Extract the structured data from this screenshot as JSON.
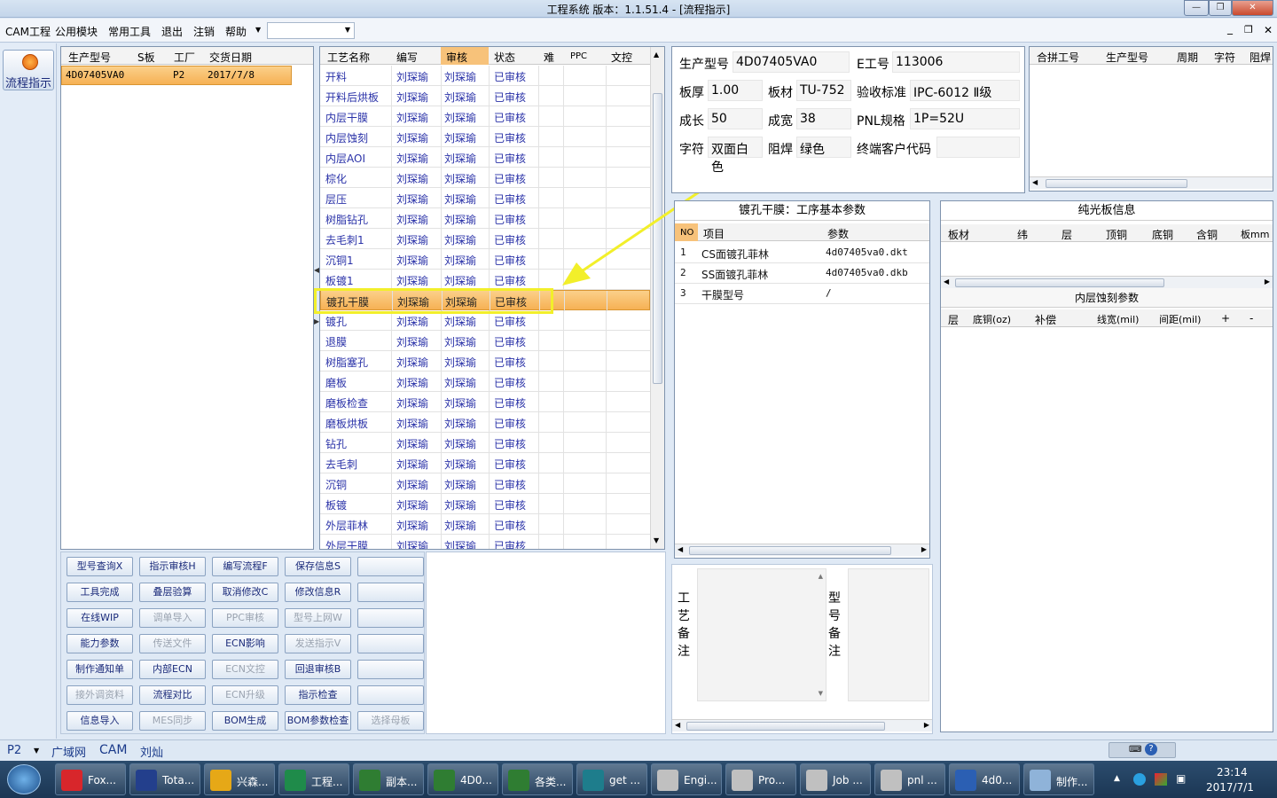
{
  "window": {
    "title": "工程系统  版本：1.1.51.4 - [流程指示]"
  },
  "menu": {
    "items": [
      "CAM工程",
      "公用模块",
      "常用工具",
      "退出",
      "注销",
      "帮助"
    ]
  },
  "side": {
    "flow_label": "流程指示"
  },
  "orders": {
    "headers": [
      "生产型号",
      "S板",
      "工厂",
      "交货日期"
    ],
    "rows": [
      {
        "model": "4D07405VA0",
        "s": "",
        "factory": "P2",
        "date": "2017/7/8"
      }
    ]
  },
  "process": {
    "headers": [
      "工艺名称",
      "编写",
      "审核",
      "状态",
      "难",
      "PPC",
      "文控"
    ],
    "rows": [
      {
        "name": "开料",
        "writer": "刘琛瑜",
        "checker": "刘琛瑜",
        "status": "已审核"
      },
      {
        "name": "开料后烘板",
        "writer": "刘琛瑜",
        "checker": "刘琛瑜",
        "status": "已审核"
      },
      {
        "name": "内层干膜",
        "writer": "刘琛瑜",
        "checker": "刘琛瑜",
        "status": "已审核"
      },
      {
        "name": "内层蚀刻",
        "writer": "刘琛瑜",
        "checker": "刘琛瑜",
        "status": "已审核"
      },
      {
        "name": "内层AOI",
        "writer": "刘琛瑜",
        "checker": "刘琛瑜",
        "status": "已审核"
      },
      {
        "name": "棕化",
        "writer": "刘琛瑜",
        "checker": "刘琛瑜",
        "status": "已审核"
      },
      {
        "name": "层压",
        "writer": "刘琛瑜",
        "checker": "刘琛瑜",
        "status": "已审核"
      },
      {
        "name": "树脂钻孔",
        "writer": "刘琛瑜",
        "checker": "刘琛瑜",
        "status": "已审核"
      },
      {
        "name": "去毛刺1",
        "writer": "刘琛瑜",
        "checker": "刘琛瑜",
        "status": "已审核"
      },
      {
        "name": "沉铜1",
        "writer": "刘琛瑜",
        "checker": "刘琛瑜",
        "status": "已审核"
      },
      {
        "name": "板镀1",
        "writer": "刘琛瑜",
        "checker": "刘琛瑜",
        "status": "已审核"
      },
      {
        "name": "镀孔干膜",
        "writer": "刘琛瑜",
        "checker": "刘琛瑜",
        "status": "已审核"
      },
      {
        "name": "镀孔",
        "writer": "刘琛瑜",
        "checker": "刘琛瑜",
        "status": "已审核"
      },
      {
        "name": "退膜",
        "writer": "刘琛瑜",
        "checker": "刘琛瑜",
        "status": "已审核"
      },
      {
        "name": "树脂塞孔",
        "writer": "刘琛瑜",
        "checker": "刘琛瑜",
        "status": "已审核"
      },
      {
        "name": "磨板",
        "writer": "刘琛瑜",
        "checker": "刘琛瑜",
        "status": "已审核"
      },
      {
        "name": "磨板检查",
        "writer": "刘琛瑜",
        "checker": "刘琛瑜",
        "status": "已审核"
      },
      {
        "name": "磨板烘板",
        "writer": "刘琛瑜",
        "checker": "刘琛瑜",
        "status": "已审核"
      },
      {
        "name": "钻孔",
        "writer": "刘琛瑜",
        "checker": "刘琛瑜",
        "status": "已审核"
      },
      {
        "name": "去毛刺",
        "writer": "刘琛瑜",
        "checker": "刘琛瑜",
        "status": "已审核"
      },
      {
        "name": "沉铜",
        "writer": "刘琛瑜",
        "checker": "刘琛瑜",
        "status": "已审核"
      },
      {
        "name": "板镀",
        "writer": "刘琛瑜",
        "checker": "刘琛瑜",
        "status": "已审核"
      },
      {
        "name": "外层菲林",
        "writer": "刘琛瑜",
        "checker": "刘琛瑜",
        "status": "已审核"
      },
      {
        "name": "外层干膜",
        "writer": "刘琛瑜",
        "checker": "刘琛瑜",
        "status": "已审核"
      }
    ],
    "selected_index": 11
  },
  "buttons": [
    [
      "型号查询X",
      "指示审核H",
      "编写流程F",
      "保存信息S",
      ""
    ],
    [
      "工具完成",
      "叠层验算",
      "取消修改C",
      "修改信息R",
      ""
    ],
    [
      "在线WIP",
      "调单导入",
      "PPC审核",
      "型号上网W",
      ""
    ],
    [
      "能力参数",
      "传送文件",
      "ECN影响",
      "发送指示V",
      ""
    ],
    [
      "制作通知单",
      "内部ECN",
      "ECN文控",
      "回退审核B",
      ""
    ],
    [
      "接外调资料",
      "流程对比",
      "ECN升级",
      "指示检查",
      ""
    ],
    [
      "信息导入",
      "MES同步",
      "BOM生成",
      "BOM参数检查",
      "选择母板"
    ]
  ],
  "button_disabled": [
    [
      false,
      false,
      false,
      false,
      false
    ],
    [
      false,
      false,
      false,
      false,
      false
    ],
    [
      false,
      true,
      true,
      true,
      false
    ],
    [
      false,
      true,
      false,
      true,
      false
    ],
    [
      false,
      false,
      true,
      false,
      false
    ],
    [
      true,
      false,
      true,
      false,
      false
    ],
    [
      false,
      true,
      false,
      false,
      true
    ]
  ],
  "info": {
    "model_label": "生产型号",
    "model": "4D07405VA0",
    "e_label": "E工号",
    "e": "113006",
    "thick_label": "板厚",
    "thick": "1.00",
    "mat_label": "板材",
    "mat": "TU-752",
    "std_label": "验收标准",
    "std": "IPC-6012 Ⅱ级",
    "len_label": "成长",
    "len": "50",
    "wid_label": "成宽",
    "wid": "38",
    "pnl_label": "PNL规格",
    "pnl": "1P=52U",
    "char_label": "字符",
    "char": "双面白色",
    "mask_label": "阻焊",
    "mask": "绿色",
    "cust_label": "终端客户代码",
    "cust": ""
  },
  "merge": {
    "headers": [
      "合拼工号",
      "生产型号",
      "周期",
      "字符",
      "阻焊"
    ]
  },
  "params": {
    "title": "镀孔干膜：工序基本参数",
    "headers": [
      "NO",
      "项目",
      "参数"
    ],
    "rows": [
      {
        "no": "1",
        "item": "CS面镀孔菲林",
        "param": "4d07405va0.dkt"
      },
      {
        "no": "2",
        "item": "SS面镀孔菲林",
        "param": "4d07405va0.dkb"
      },
      {
        "no": "3",
        "item": "干膜型号",
        "param": "/"
      }
    ]
  },
  "bare": {
    "title": "纯光板信息",
    "headers": [
      "板材",
      "纬",
      "层",
      "顶铜",
      "底铜",
      "含铜",
      "板mm"
    ]
  },
  "inner": {
    "title": "内层蚀刻参数",
    "headers": [
      "层",
      "底铜(oz)",
      "补偿",
      "线宽(mil)",
      "间距(mil)",
      "+",
      "-"
    ]
  },
  "remarks": {
    "proc_label": "工艺备注",
    "model_label": "型号备注"
  },
  "status": {
    "factory": "P2",
    "items": [
      "广域网",
      "CAM",
      "刘灿"
    ]
  },
  "taskbar": {
    "items": [
      "Fox...",
      "Tota...",
      "兴森...",
      "工程...",
      "副本...",
      "4D0...",
      "各类...",
      "get ...",
      "Engi...",
      "Pro...",
      "Job ...",
      "pnl ...",
      "4d0...",
      "制作..."
    ],
    "time": "23:14",
    "date": "2017/7/1"
  }
}
